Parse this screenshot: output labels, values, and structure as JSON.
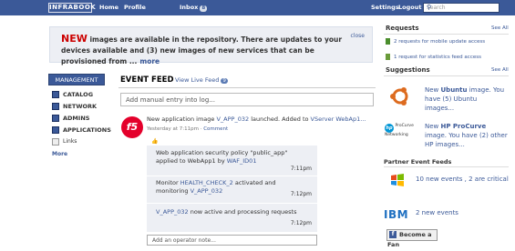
{
  "topbar": {
    "logo": "INFRABOOK",
    "nav": [
      "Home",
      "Profile"
    ],
    "inbox_label": "Inbox",
    "inbox_count": "8",
    "right_nav": [
      "Settings",
      "Logout"
    ],
    "search_placeholder": "Search"
  },
  "announce": {
    "new_word": "NEW",
    "text": " images are available in the repository. There are updates to your devices available and (3) new images of new services that can be provisioned from ...",
    "more": "more",
    "close": "close"
  },
  "leftnav": {
    "header": "MANAGEMENT",
    "items": [
      "CATALOG",
      "NETWORK",
      "ADMINS",
      "APPLICATIONS"
    ],
    "links": "Links",
    "more": "More"
  },
  "feed": {
    "title": "EVENT FEED",
    "live_label": "View Live Feed",
    "live_count": "9",
    "manual_placeholder": "Add manual entry into log...",
    "post": {
      "prefix": "New application image ",
      "image": "V_APP_032",
      "middle": " launched. Added to ",
      "target": "VServer WebAp1...",
      "time": "Yesterday at 7:11pm",
      "sep": " · ",
      "comment": "Comment"
    },
    "comments": [
      {
        "pre": "Web application security policy \"public_app\" applied to WebApp1 by ",
        "link": "WAF_ID01",
        "post": "",
        "time": "7:11pm"
      },
      {
        "pre": "Monitor ",
        "link": "HEALTH_CHECK_2",
        "post": " activated and monitoring ",
        "link2": "V_APP_032",
        "time": "7:12pm"
      },
      {
        "pre": "",
        "link": "V_APP_032",
        "post": " now active and processing requests",
        "time": "7:12pm"
      }
    ],
    "operator_placeholder": "Add an operator note..."
  },
  "right": {
    "requests_title": "Requests",
    "see_all": "See All",
    "requests": [
      "2 requests for mobile update access",
      "1 request for statistics feed access"
    ],
    "suggestions_title": "Suggestions",
    "sug1": {
      "a": "New ",
      "b": "Ubuntu",
      "c": " image. You have (5) Ubuntu images..."
    },
    "sug2": {
      "a": "New ",
      "b": "HP ProCurve",
      "c": " image. You have (2) other HP images..."
    },
    "hp_label": "ProCurve Networking",
    "partner_title": "Partner Event Feeds",
    "partner1": {
      "num": "10 new events",
      "sep": " , ",
      "crit": "2 are critical"
    },
    "ibm": "IBM",
    "partner2": "2 new events",
    "fan": "Become a Fan"
  }
}
